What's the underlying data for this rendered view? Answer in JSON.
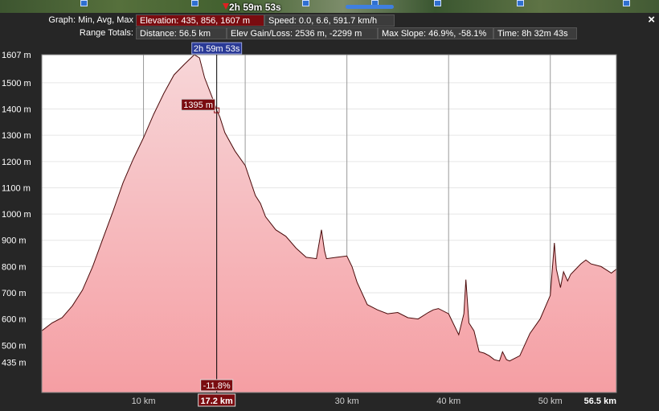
{
  "header": {
    "title": "2h 59m 53s",
    "close": "×"
  },
  "summary": {
    "graph_label": "Graph: Min, Avg, Max",
    "elevation": "Elevation: 435, 856, 1607 m",
    "speed": "Speed: 0.0, 6.6, 591.7 km/h",
    "range_label": "Range Totals:",
    "distance": "Distance: 56.5 km",
    "elev_gain": "Elev Gain/Loss: 2536 m, -2299 m",
    "max_slope": "Max Slope: 46.9%, -58.1%",
    "time": "Time: 8h 32m 43s"
  },
  "cursor": {
    "time": "2h 59m 53s",
    "elevation": "1395 m",
    "slope": "-11.8%",
    "distance": "17.2 km",
    "x": 17.2,
    "y": 1395
  },
  "chart_data": {
    "type": "area",
    "title": "",
    "xlabel": "",
    "ylabel": "",
    "xlim": [
      0,
      56.5
    ],
    "ylim": [
      320,
      1607
    ],
    "x_ticks": [
      10,
      20,
      30,
      40,
      50
    ],
    "x_tick_labels": [
      "10 km",
      "",
      "30 km",
      "40 km",
      "50 km"
    ],
    "x_end_label": "56.5 km",
    "y_tick_labels": [
      {
        "v": 1607,
        "label": "1607 m"
      },
      {
        "v": 1500,
        "label": "1500 m"
      },
      {
        "v": 1400,
        "label": "1400 m"
      },
      {
        "v": 1300,
        "label": "1300 m"
      },
      {
        "v": 1200,
        "label": "1200 m"
      },
      {
        "v": 1100,
        "label": "1100 m"
      },
      {
        "v": 1000,
        "label": "1000 m"
      },
      {
        "v": 900,
        "label": "900 m"
      },
      {
        "v": 800,
        "label": "800 m"
      },
      {
        "v": 700,
        "label": "700 m"
      },
      {
        "v": 600,
        "label": "600 m"
      },
      {
        "v": 500,
        "label": "500 m"
      },
      {
        "v": 435,
        "label": "435 m"
      }
    ],
    "colors": {
      "fill_top": "#f7d6d8",
      "fill_bottom": "#f59ea3",
      "line": "#4a0a0a",
      "grid": "#9a9a9a",
      "cursor": "#000000"
    },
    "series": [
      {
        "x": [
          0,
          1,
          2,
          3,
          4,
          5,
          6,
          7,
          8,
          9,
          10,
          11,
          12,
          13,
          14,
          15,
          15.5,
          16,
          16.5,
          17,
          17.2,
          17.5,
          18,
          19,
          20,
          21,
          21.5,
          22,
          23,
          24,
          25,
          26,
          27,
          27.5,
          27.8,
          28,
          29,
          30,
          30.5,
          31,
          32,
          33,
          34,
          35,
          36,
          37,
          38,
          38.5,
          39,
          40,
          41,
          41.5,
          41.7,
          42,
          42.5,
          43,
          43.5,
          44,
          44.5,
          45,
          45.3,
          45.7,
          46,
          47,
          48,
          49,
          50,
          50.4,
          50.6,
          51,
          51.3,
          51.7,
          52,
          53,
          53.5,
          54,
          55,
          56,
          56.5
        ],
        "y": [
          555,
          585,
          605,
          650,
          710,
          800,
          905,
          1010,
          1120,
          1210,
          1290,
          1380,
          1460,
          1530,
          1570,
          1607,
          1595,
          1520,
          1470,
          1420,
          1395,
          1370,
          1310,
          1240,
          1185,
          1070,
          1040,
          990,
          940,
          915,
          870,
          835,
          830,
          940,
          860,
          830,
          835,
          840,
          800,
          740,
          655,
          635,
          620,
          625,
          605,
          600,
          625,
          635,
          640,
          620,
          540,
          620,
          750,
          585,
          555,
          475,
          470,
          460,
          445,
          440,
          475,
          445,
          440,
          460,
          545,
          600,
          690,
          890,
          790,
          720,
          780,
          745,
          770,
          810,
          825,
          810,
          800,
          775,
          790
        ]
      }
    ]
  }
}
